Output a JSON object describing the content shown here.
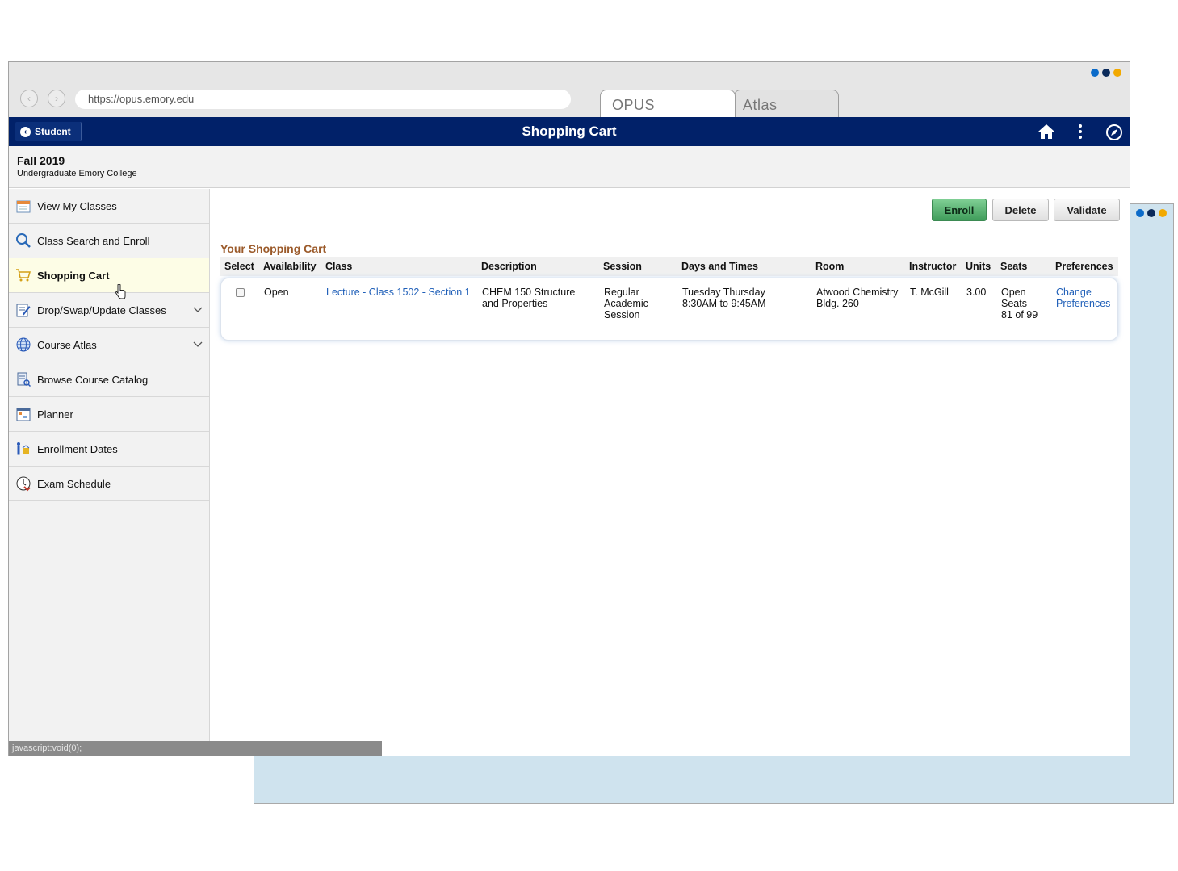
{
  "colors": {
    "header_bg": "#012169",
    "accent_blue": "#0b6bc9",
    "accent_navy": "#0a2a5a",
    "accent_gold": "#f2a900",
    "cart_title": "#9b5a2a",
    "link": "#1f5fb8",
    "enroll_green": "#4caf6a",
    "back_window": "#cfe3ee"
  },
  "browser": {
    "url": "https://opus.emory.edu",
    "tabs": [
      {
        "label": "OPUS"
      },
      {
        "label": "Atlas"
      }
    ],
    "status_text": "javascript:void(0);"
  },
  "header": {
    "back_label": "Student",
    "title": "Shopping Cart",
    "icons": [
      "home-icon",
      "more-vertical-icon",
      "compass-icon"
    ]
  },
  "term": {
    "title": "Fall 2019",
    "subtitle": "Undergraduate Emory College"
  },
  "sidebar": {
    "items": [
      {
        "label": "View My Classes",
        "icon": "calendar-icon"
      },
      {
        "label": "Class Search and Enroll",
        "icon": "search-icon"
      },
      {
        "label": "Shopping Cart",
        "icon": "cart-icon",
        "active": true
      },
      {
        "label": "Drop/Swap/Update Classes",
        "icon": "edit-icon",
        "expandable": true
      },
      {
        "label": "Course Atlas",
        "icon": "globe-icon",
        "expandable": true
      },
      {
        "label": "Browse Course Catalog",
        "icon": "catalog-icon"
      },
      {
        "label": "Planner",
        "icon": "planner-icon"
      },
      {
        "label": "Enrollment Dates",
        "icon": "enrollment-dates-icon"
      },
      {
        "label": "Exam Schedule",
        "icon": "clock-icon"
      }
    ]
  },
  "actions": {
    "enroll": "Enroll",
    "delete": "Delete",
    "validate": "Validate"
  },
  "cart": {
    "title": "Your Shopping Cart",
    "columns": [
      "Select",
      "Availability",
      "Class",
      "Description",
      "Session",
      "Days and Times",
      "Room",
      "Instructor",
      "Units",
      "Seats",
      "Preferences"
    ],
    "rows": [
      {
        "availability": "Open",
        "class": "Lecture - Class 1502 - Section 1",
        "description_1": "CHEM 150 Structure",
        "description_2": "and Properties",
        "session_1": "Regular",
        "session_2": "Academic",
        "session_3": "Session",
        "days": "Tuesday Thursday",
        "times": "8:30AM to 9:45AM",
        "room_1": "Atwood Chemistry",
        "room_2": "Bldg. 260",
        "instructor": "T. McGill",
        "units": "3.00",
        "seats_1": "Open",
        "seats_2": "Seats",
        "seats_3": "81 of 99",
        "preferences_1": "Change",
        "preferences_2": "Preferences"
      }
    ]
  }
}
